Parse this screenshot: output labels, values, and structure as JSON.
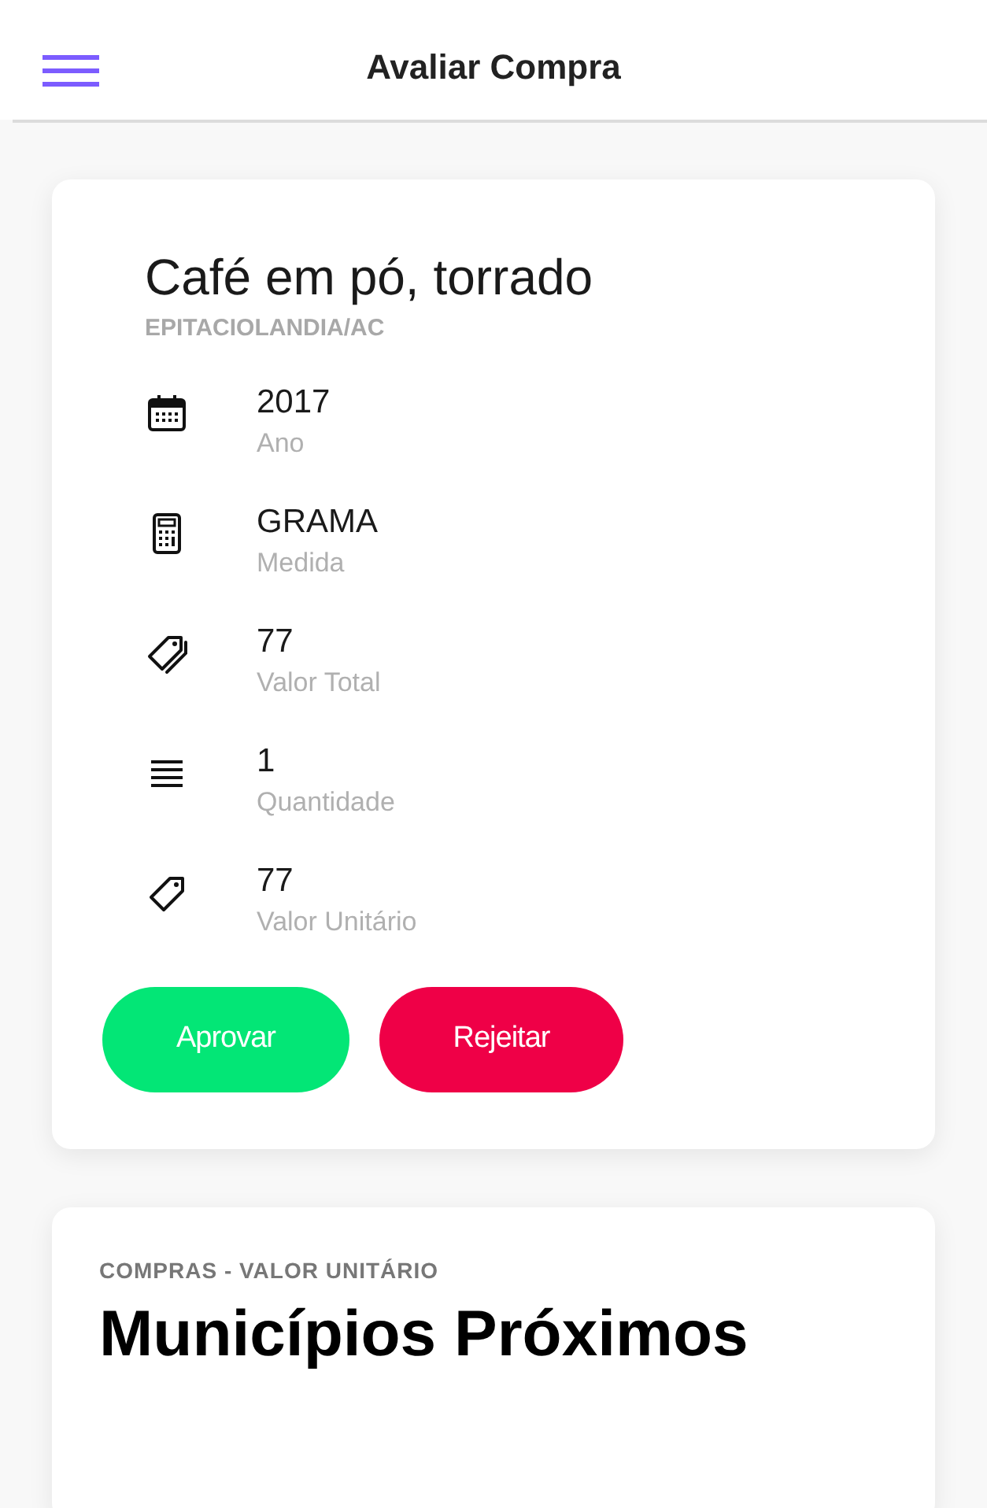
{
  "header": {
    "title": "Avaliar Compra"
  },
  "purchase": {
    "title": "Café em pó, torrado",
    "location": "EPITACIOLANDIA/AC",
    "details": [
      {
        "kind": "calendar",
        "value": "2017",
        "label": "Ano"
      },
      {
        "kind": "calculator",
        "value": "GRAMA",
        "label": "Medida"
      },
      {
        "kind": "tags",
        "value": "77",
        "label": "Valor Total"
      },
      {
        "kind": "list",
        "value": "1",
        "label": "Quantidade"
      },
      {
        "kind": "tag",
        "value": "77",
        "label": "Valor Unitário"
      }
    ],
    "buttons": [
      {
        "kind": "approve",
        "label": "Aprovar"
      },
      {
        "kind": "reject",
        "label": "Rejeitar"
      }
    ]
  },
  "nearby": {
    "subtitle": "COMPRAS - VALOR UNITÁRIO",
    "title": "Municípios Próximos"
  }
}
